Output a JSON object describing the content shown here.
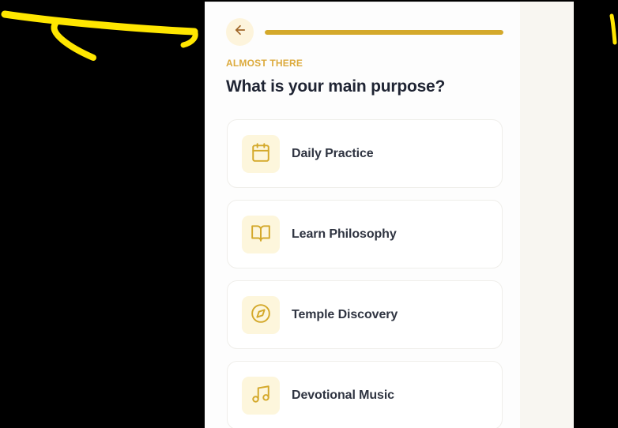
{
  "header": {
    "back_icon": "arrow-left-icon",
    "progress": 1.0
  },
  "eyebrow": "ALMOST THERE",
  "question": "What is your main purpose?",
  "options": [
    {
      "label": "Daily Practice",
      "icon": "calendar-icon"
    },
    {
      "label": "Learn Philosophy",
      "icon": "book-open-icon"
    },
    {
      "label": "Temple Discovery",
      "icon": "compass-icon"
    },
    {
      "label": "Devotional Music",
      "icon": "music-note-icon"
    }
  ],
  "colors": {
    "accent": "#d4a92b",
    "accent_light": "#fdf6dc",
    "heading": "#1f2433",
    "eyebrow": "#dcaa3c",
    "annotation": "#ffe600"
  }
}
